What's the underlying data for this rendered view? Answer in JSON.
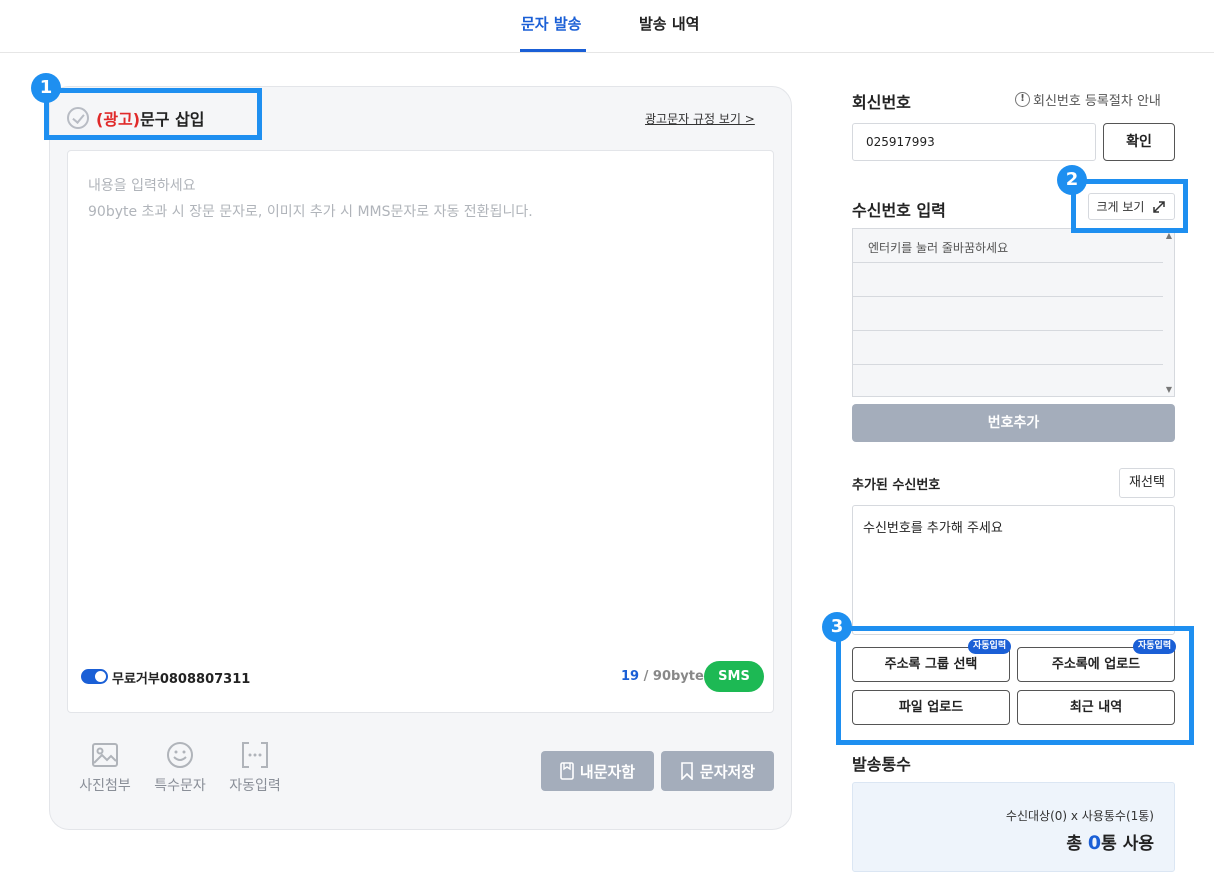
{
  "tabs": [
    {
      "label": "문자 발송",
      "active": true
    },
    {
      "label": "발송 내역",
      "active": false
    }
  ],
  "composer": {
    "ad_prefix": "(광고)",
    "ad_title": "문구 삽입",
    "ad_rule_link": "광고문자 규정 보기 >",
    "placeholder_line1": "내용을 입력하세요",
    "placeholder_line2": "90byte 초과 시 장문 문자로, 이미지 추가 시 MMS문자로 자동 전환됩니다.",
    "reject_label": "무료거부0808807311",
    "byte_current": "19",
    "byte_limit": "/ 90byte",
    "msg_type": "SMS",
    "tools": [
      {
        "label": "사진첨부",
        "icon": "image-icon"
      },
      {
        "label": "특수문자",
        "icon": "smiley-icon"
      },
      {
        "label": "자동입력",
        "icon": "bracket-dots-icon"
      }
    ],
    "my_box_label": "내문자함",
    "save_label": "문자저장"
  },
  "callback": {
    "title": "회신번호",
    "guide_label": "회신번호 등록절차 안내",
    "number_value": "025917993",
    "confirm_label": "확인"
  },
  "recipients": {
    "title": "수신번호 입력",
    "enlarge_label": "크게 보기",
    "input_placeholder": "엔터키를 눌러 줄바꿈하세요",
    "add_label": "번호추가",
    "added_title": "추가된 수신번호",
    "reselect_label": "재선택",
    "added_empty": "수신번호를 추가해 주세요",
    "auto_badge": "자동입력",
    "group_select_label": "주소록 그룹 선택",
    "addr_upload_label": "주소록에 업로드",
    "file_upload_label": "파일 업로드",
    "recent_label": "최근 내역"
  },
  "count": {
    "title": "발송통수",
    "formula": "수신대상(0) x 사용통수(1통)",
    "total_prefix": "총",
    "total_value": "0",
    "total_suffix": "통 사용"
  },
  "markers": [
    "1",
    "2",
    "3"
  ],
  "colors": {
    "accent": "#1a5fd6",
    "highlight": "#1e8ff0",
    "ad_red": "#e02a2a",
    "sms_green": "#1db954",
    "disabled_button": "#a4adbb"
  }
}
